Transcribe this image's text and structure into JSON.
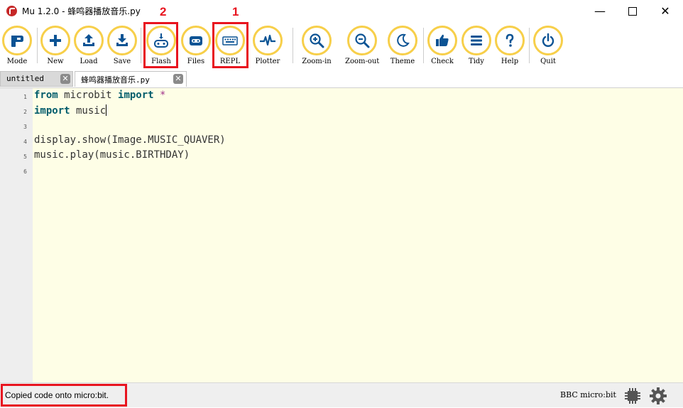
{
  "window": {
    "title": "Mu 1.2.0 - 蜂鸣器播放音乐.py",
    "minimize": "—",
    "close": "✕"
  },
  "toolbar": {
    "buttons": [
      {
        "label": "Mode",
        "icon": "mode-icon"
      },
      {
        "label": "New",
        "icon": "plus-icon"
      },
      {
        "label": "Load",
        "icon": "upload-icon"
      },
      {
        "label": "Save",
        "icon": "download-icon"
      },
      {
        "label": "Flash",
        "icon": "flash-icon"
      },
      {
        "label": "Files",
        "icon": "files-icon"
      },
      {
        "label": "REPL",
        "icon": "keyboard-icon"
      },
      {
        "label": "Plotter",
        "icon": "pulse-icon"
      },
      {
        "label": "Zoom-in",
        "icon": "zoom-in-icon"
      },
      {
        "label": "Zoom-out",
        "icon": "zoom-out-icon"
      },
      {
        "label": "Theme",
        "icon": "moon-icon"
      },
      {
        "label": "Check",
        "icon": "thumbs-up-icon"
      },
      {
        "label": "Tidy",
        "icon": "lines-icon"
      },
      {
        "label": "Help",
        "icon": "question-icon"
      },
      {
        "label": "Quit",
        "icon": "power-icon"
      }
    ],
    "accent_color": "#f7cf4a",
    "icon_color": "#0b5394"
  },
  "annotations": {
    "callout_1": "1",
    "callout_2": "2",
    "highlight_color": "#e8141f"
  },
  "tabs": [
    {
      "name": "untitled",
      "active": false
    },
    {
      "name": "蜂鸣器播放音乐.py",
      "active": true
    }
  ],
  "editor": {
    "line_numbers": [
      "1",
      "2",
      "3",
      "4",
      "5",
      "6"
    ],
    "lines": [
      {
        "kw1": "from",
        "mid": " microbit ",
        "kw2": "import",
        "tail": " *"
      },
      {
        "kw1": "import",
        "mid": " music"
      },
      {},
      {
        "text": "display.show(Image.MUSIC_QUAVER)"
      },
      {
        "text": "music.play(music.BIRTHDAY)"
      },
      {}
    ],
    "background": "#fefee6"
  },
  "status": {
    "message": "Copied code onto micro:bit.",
    "board": "BBC micro:bit",
    "chip_icon": "chip-icon",
    "settings_icon": "gear-icon"
  }
}
